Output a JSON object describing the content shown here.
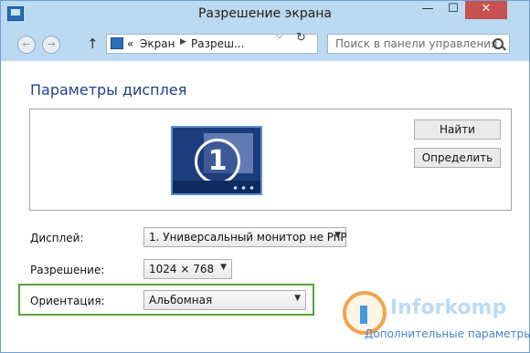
{
  "window": {
    "title": "Разрешение экрана"
  },
  "titlebar": {
    "min_glyph": "—",
    "max_glyph": "☐",
    "close_glyph": "✕"
  },
  "nav": {
    "back_glyph": "←",
    "forward_glyph": "→",
    "up_glyph": "↑",
    "breadcrumb_prefix": "«",
    "breadcrumb": [
      "Экран",
      "Разреш..."
    ],
    "separator_glyph": "▶",
    "dropdown_glyph": "⌵",
    "refresh_glyph": "↻",
    "search_placeholder": "Поиск в панели управления"
  },
  "page": {
    "title": "Параметры дисплея"
  },
  "preview": {
    "monitor_number": "1"
  },
  "buttons": {
    "find": "Найти",
    "identify": "Определить"
  },
  "settings": {
    "display": {
      "label": "Дисплей:",
      "value": "1. Универсальный монитор не PnP"
    },
    "resolution": {
      "label": "Разрешение:",
      "value": "1024 × 768"
    },
    "orientation": {
      "label": "Ориентация:",
      "value": "Альбомная"
    },
    "chevron_glyph": "▼"
  },
  "watermark": {
    "brand": "Inforkomp",
    "link": "Дополнительные параметры"
  },
  "colors": {
    "accent": "#1f3f8a",
    "highlight": "#58a33a",
    "close": "#c75050"
  }
}
